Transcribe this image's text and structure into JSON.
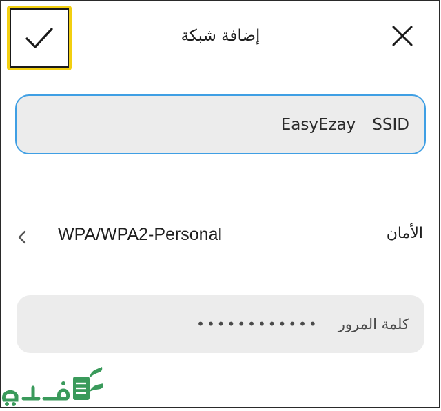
{
  "header": {
    "title": "إضافة شبكة",
    "confirm_icon": "check-icon",
    "close_icon": "close-icon"
  },
  "ssid": {
    "label": "SSID",
    "value": "EasyEzay"
  },
  "security": {
    "label": "الأمان",
    "value": "WPA/WPA2-Personal",
    "icon": "chevron-left-icon"
  },
  "password": {
    "label": "كلمة المرور",
    "value": "••••••••••••"
  },
  "watermark": {
    "text": "فكرة"
  },
  "colors": {
    "focus_border": "#3f9fe4",
    "highlight": "#f2cf10",
    "field_bg": "#ececec",
    "watermark_green": "#3a9a5b"
  }
}
